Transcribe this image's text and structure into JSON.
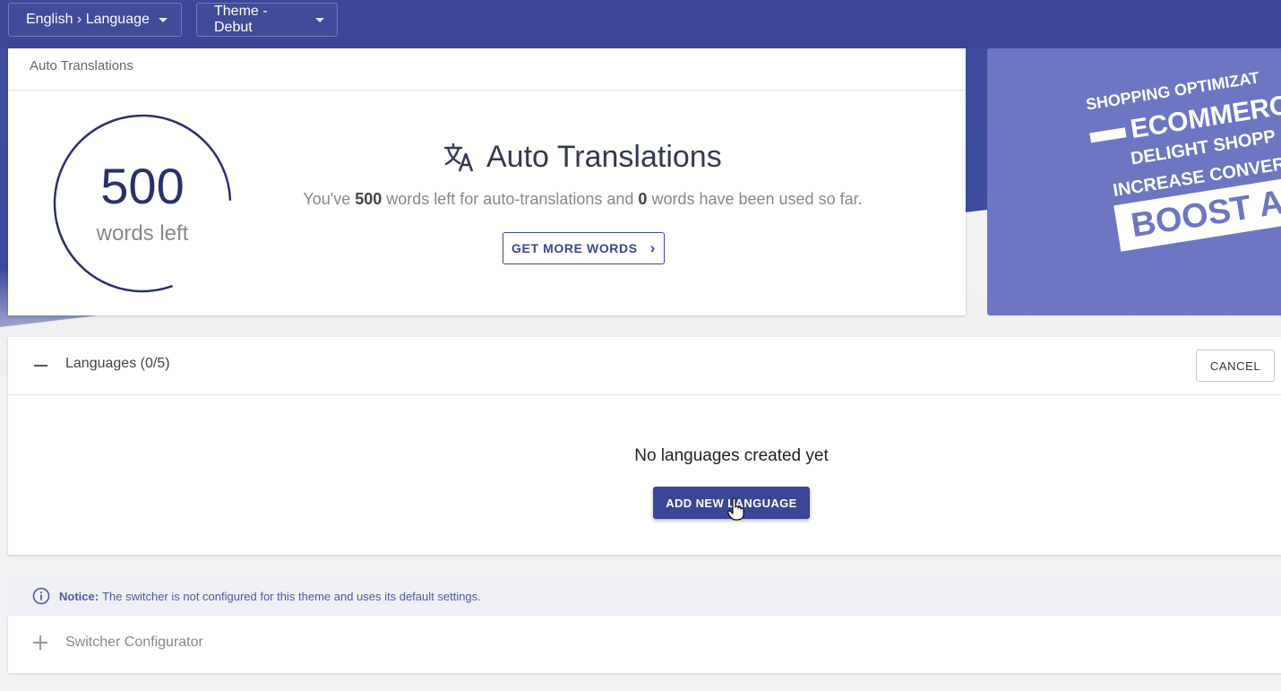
{
  "topbar": {
    "language_dropdown": "English › Language",
    "theme_dropdown": "Theme - Debut"
  },
  "auto_translations": {
    "header": "Auto Translations",
    "words_left_number": "500",
    "words_left_label": "words left",
    "title": "Auto Translations",
    "desc_part1": "You've ",
    "desc_words_left": "500",
    "desc_part2": " words left for auto-translations and ",
    "desc_words_used": "0",
    "desc_part3": " words have been used so far.",
    "get_more_button": "GET MORE WORDS",
    "ring_fraction": 0.8
  },
  "banner": {
    "line1": "SHOPPING OPTIMIZAT",
    "line2": "ECOMMERC",
    "line3": "DELIGHT SHOPP",
    "line4": "INCREASE CONVER",
    "line5": "BOOST AC"
  },
  "languages": {
    "title": "Languages (0/5)",
    "cancel_button": "CANCEL",
    "empty_message": "No languages created yet",
    "add_button": "ADD NEW LANGUAGE"
  },
  "notice": {
    "label": "Notice:",
    "text": "The switcher is not configured for this theme and uses its default settings."
  },
  "switcher": {
    "title": "Switcher Configurator"
  },
  "colors": {
    "primary": "#3a4696",
    "banner": "#6d76c2",
    "ring": "#29306c"
  }
}
